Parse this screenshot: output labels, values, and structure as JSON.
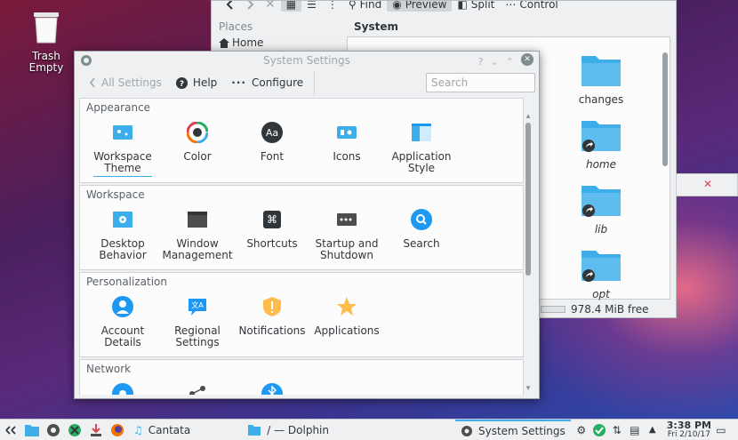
{
  "desktop": {
    "trash_label": "Trash",
    "trash_status": "Empty"
  },
  "dolphin": {
    "toolbar": {
      "find": "Find",
      "preview": "Preview",
      "split": "Split",
      "control": "Control"
    },
    "places_header": "Places",
    "home": "Home",
    "current_folder": "System",
    "files": [
      "changes",
      "home",
      "lib",
      "opt"
    ],
    "free_space": "978.4 MiB free"
  },
  "settings": {
    "title": "System Settings",
    "toolbar": {
      "back": "All Settings",
      "help": "Help",
      "configure": "Configure"
    },
    "search_placeholder": "Search",
    "sections": [
      {
        "header": "Appearance",
        "items": [
          "Workspace Theme",
          "Color",
          "Font",
          "Icons",
          "Application Style"
        ]
      },
      {
        "header": "Workspace",
        "items": [
          "Desktop Behavior",
          "Window Management",
          "Shortcuts",
          "Startup and Shutdown",
          "Search"
        ]
      },
      {
        "header": "Personalization",
        "items": [
          "Account Details",
          "Regional Settings",
          "Notifications",
          "Applications"
        ]
      },
      {
        "header": "Network",
        "items": []
      }
    ]
  },
  "taskbar": {
    "tasks": [
      "Cantata",
      "/ — Dolphin",
      "System Settings"
    ],
    "time": "3:38 PM",
    "date": "Fri 2/10/17"
  },
  "colors": {
    "accent": "#3daee9",
    "panel": "#eff0f1",
    "folder": "#3daee9"
  }
}
